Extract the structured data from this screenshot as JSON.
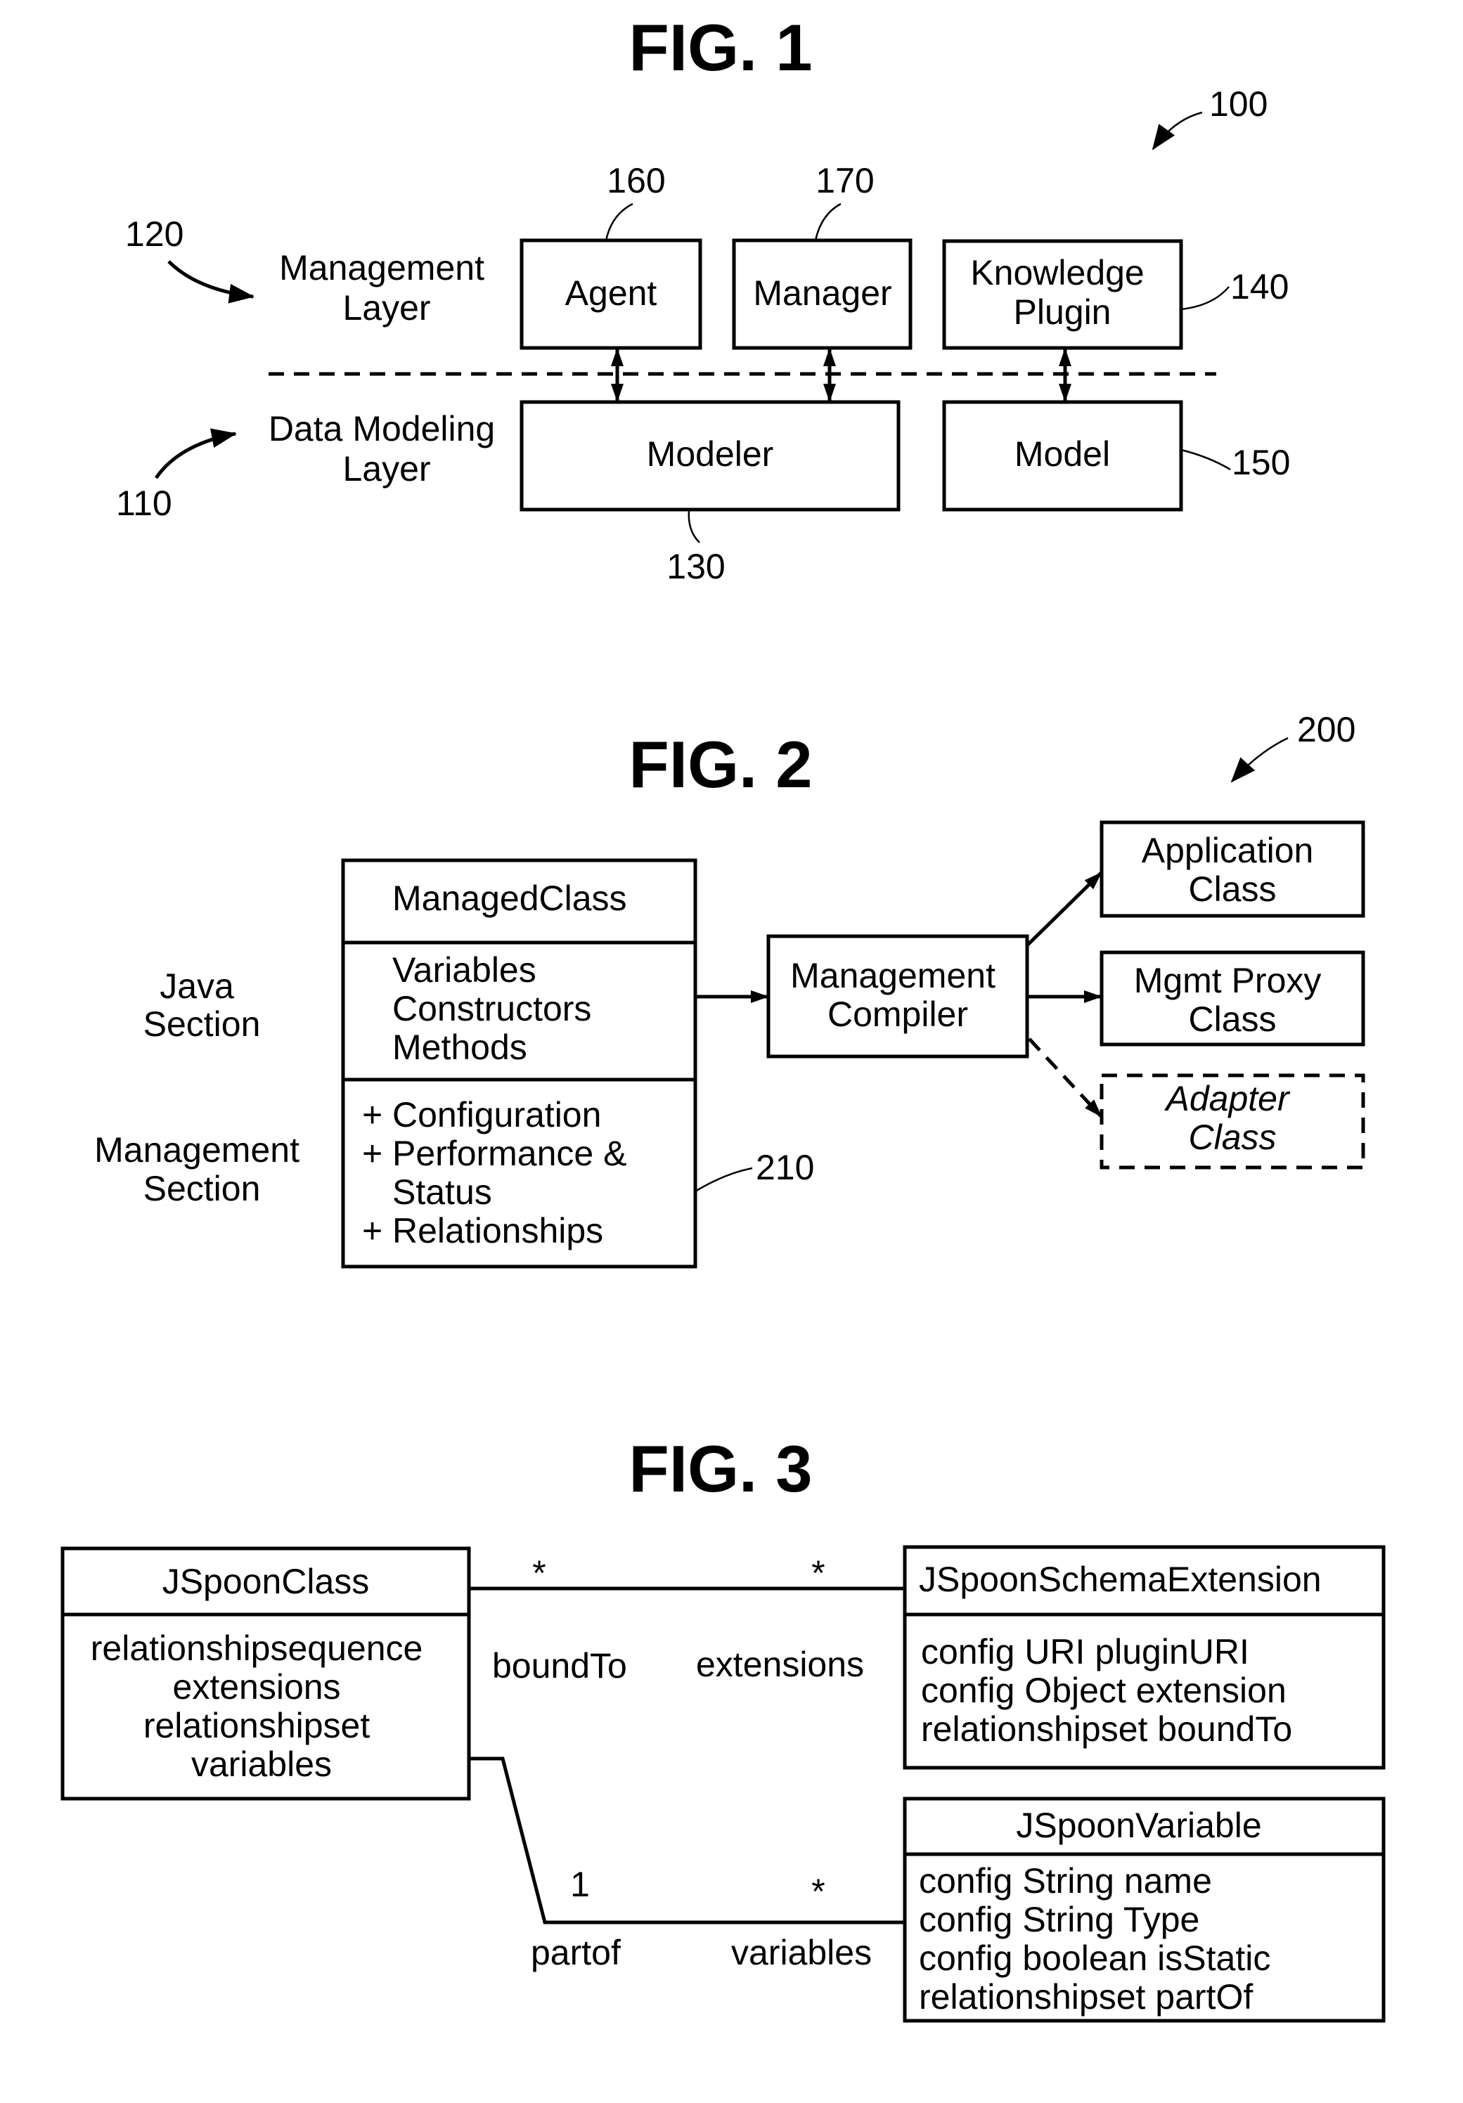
{
  "fig1": {
    "title": "FIG. 1",
    "ref_system": "100",
    "management_layer": {
      "ref": "120",
      "line1": "Management",
      "line2": "Layer"
    },
    "data_modeling_layer": {
      "ref": "110",
      "line1": "Data Modeling",
      "line2": "Layer"
    },
    "agent": {
      "label": "Agent",
      "ref": "160"
    },
    "manager": {
      "label": "Manager",
      "ref": "170"
    },
    "knowledge_plugin": {
      "line1": "Knowledge",
      "line2": "Plugin",
      "ref": "140"
    },
    "modeler": {
      "label": "Modeler",
      "ref": "130"
    },
    "model": {
      "label": "Model",
      "ref": "150"
    }
  },
  "fig2": {
    "title": "FIG. 2",
    "ref_system": "200",
    "java_section": {
      "line1": "Java",
      "line2": "Section"
    },
    "management_section": {
      "line1": "Management",
      "line2": "Section"
    },
    "managed_class": {
      "name": "ManagedClass",
      "java_members": [
        "Variables",
        "Constructors",
        "Methods"
      ],
      "management_members": [
        "Configuration",
        "Performance &",
        "Status",
        "Relationships"
      ],
      "bullet": "+",
      "ref": "210"
    },
    "compiler": {
      "line1": "Management",
      "line2": "Compiler"
    },
    "outputs": [
      {
        "line1": "Application",
        "line2": "Class"
      },
      {
        "line1": "Mgmt Proxy",
        "line2": "Class"
      },
      {
        "line1": "Adapter",
        "line2": "Class"
      }
    ]
  },
  "fig3": {
    "title": "FIG. 3",
    "jspoon_class": {
      "name": "JSpoonClass",
      "members": [
        "relationshipsequence",
        "extensions",
        "relationshipset",
        "variables"
      ]
    },
    "schema_extension": {
      "name": "JSpoonSchemaExtension",
      "members": [
        "config URI pluginURI",
        "config Object extension",
        "relationshipset boundTo"
      ]
    },
    "jspoon_variable": {
      "name": "JSpoonVariable",
      "members": [
        "config String name",
        "config String Type",
        "config boolean isStatic",
        "relationshipset partOf"
      ]
    },
    "assoc_top": {
      "mult_left": "*",
      "mult_right": "*",
      "role_left": "boundTo",
      "role_right": "extensions"
    },
    "assoc_bottom": {
      "mult_left": "1",
      "mult_right": "*",
      "role_left": "partof",
      "role_right": "variables"
    }
  }
}
